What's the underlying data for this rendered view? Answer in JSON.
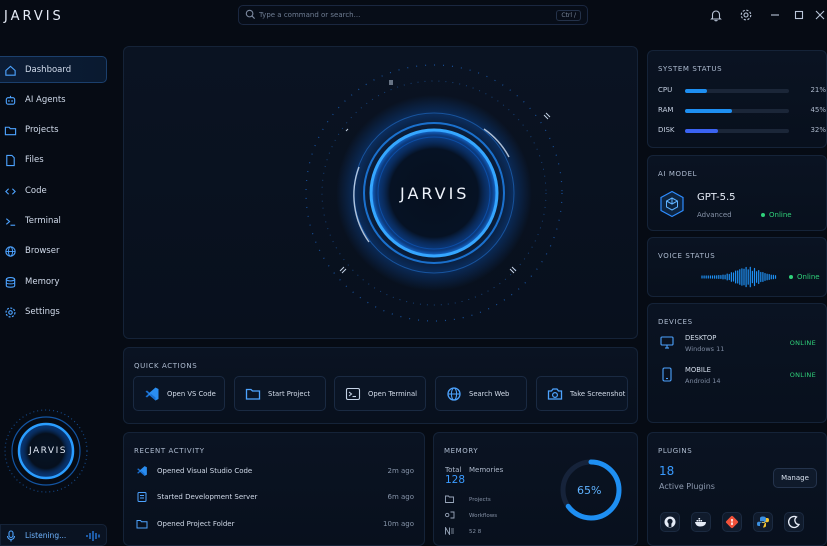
{
  "app": {
    "brand": "JARVIS"
  },
  "search": {
    "placeholder": "Type a command or search...",
    "shortcut": "Ctrl /"
  },
  "sidebar": {
    "items": [
      {
        "label": "Dashboard",
        "icon": "home-icon",
        "active": true
      },
      {
        "label": "AI Agents",
        "icon": "robot-icon"
      },
      {
        "label": "Projects",
        "icon": "folder-icon"
      },
      {
        "label": "Files",
        "icon": "file-icon"
      },
      {
        "label": "Code",
        "icon": "code-icon"
      },
      {
        "label": "Terminal",
        "icon": "terminal-icon"
      },
      {
        "label": "Browser",
        "icon": "globe-icon"
      },
      {
        "label": "Memory",
        "icon": "database-icon"
      },
      {
        "label": "Settings",
        "icon": "gear-icon"
      }
    ],
    "mini_core_label": "JARVIS",
    "listening_label": "Listening..."
  },
  "core": {
    "label": "JARVIS"
  },
  "quick_actions": {
    "title": "QUICK ACTIONS",
    "items": [
      {
        "label": "Open VS Code",
        "icon": "vscode-icon"
      },
      {
        "label": "Start Project",
        "icon": "folder-icon"
      },
      {
        "label": "Open Terminal",
        "icon": "terminal-icon"
      },
      {
        "label": "Search Web",
        "icon": "globe-icon"
      },
      {
        "label": "Take Screenshot",
        "icon": "camera-icon"
      }
    ]
  },
  "recent_activity": {
    "title": "RECENT ACTIVITY",
    "items": [
      {
        "text": "Opened Visual Studio Code",
        "time": "2m ago",
        "icon": "vscode-icon"
      },
      {
        "text": "Started Development Server",
        "time": "6m ago",
        "icon": "server-icon"
      },
      {
        "text": "Opened Project Folder",
        "time": "10m ago",
        "icon": "folder-icon"
      }
    ]
  },
  "memory": {
    "title": "MEMORY",
    "total_label": "Total",
    "total_value": "128",
    "memories_label": "Memories",
    "rows": [
      {
        "label": "Projects"
      },
      {
        "label": "Workflows"
      },
      {
        "label": "52 8"
      }
    ],
    "percent_text": "65%",
    "percent": 65
  },
  "system_status": {
    "title": "SYSTEM STATUS",
    "items": [
      {
        "label": "CPU",
        "value_text": "21%",
        "value": 21,
        "color": "#1e8ff2"
      },
      {
        "label": "RAM",
        "value_text": "45%",
        "value": 45,
        "color": "#1e8ff2"
      },
      {
        "label": "DISK",
        "value_text": "32%",
        "value": 32,
        "color": "#3b63f2"
      }
    ]
  },
  "ai_model": {
    "title": "AI MODEL",
    "name": "GPT-5.5",
    "tier": "Advanced",
    "status": "Online"
  },
  "voice_status": {
    "title": "VOICE STATUS",
    "status": "Online"
  },
  "devices": {
    "title": "DEVICES",
    "items": [
      {
        "name": "DESKTOP",
        "sub": "Windows 11",
        "status": "ONLINE",
        "icon": "monitor-icon"
      },
      {
        "name": "MOBILE",
        "sub": "Android 14",
        "status": "ONLINE",
        "icon": "phone-icon"
      }
    ]
  },
  "plugins": {
    "title": "PLUGINS",
    "count": "18",
    "count_label": "Active Plugins",
    "manage_label": "Manage",
    "icons": [
      "github-icon",
      "docker-icon",
      "git-icon",
      "python-icon",
      "theme-icon"
    ]
  },
  "colors": {
    "accent": "#1e8ff2",
    "online": "#2fd17a",
    "background": "#060b14"
  }
}
